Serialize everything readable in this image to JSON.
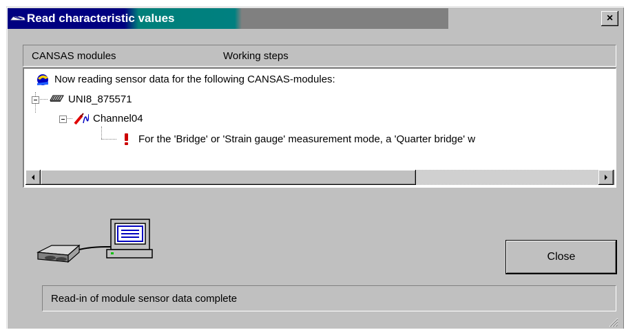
{
  "window": {
    "title": "Read characteristic values",
    "close_glyph": "×"
  },
  "header": {
    "col1": "CANSAS modules",
    "col2": "Working steps"
  },
  "tree": {
    "root_text": "Now reading sensor data for the following CANSAS-modules:",
    "module": "UNI8_875571",
    "channel": "Channel04",
    "message": "For the 'Bridge' or 'Strain gauge' measurement mode, a 'Quarter bridge' w"
  },
  "button": {
    "close_label": "Close"
  },
  "status": {
    "text": "Read-in of module sensor data complete"
  },
  "colors": {
    "title_active": "#000080",
    "title_mid": "#008080",
    "title_inactive": "#808080",
    "face": "#c0c0c0",
    "warning": "#cc0000"
  },
  "icons": {
    "title": "module-car-icon",
    "root": "read-sensor-icon",
    "module": "can-module-icon",
    "channel": "sensor-channel-icon",
    "message": "exclamation-warning-icon"
  }
}
